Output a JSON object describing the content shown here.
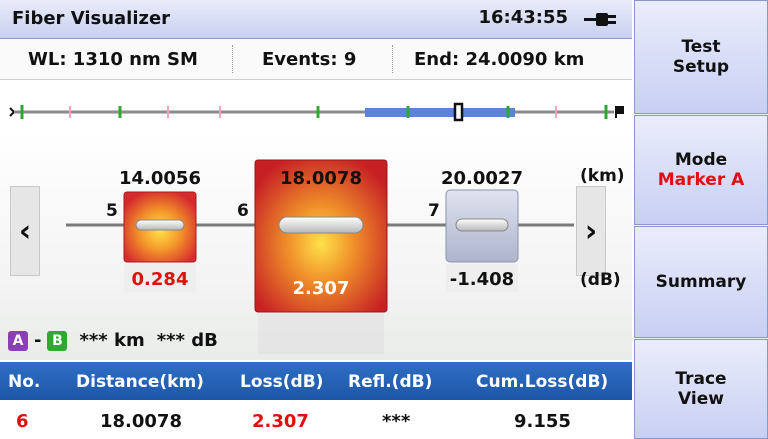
{
  "header": {
    "title": "Fiber Visualizer",
    "time": "16:43:55",
    "power_icon": "plug-icon"
  },
  "info": {
    "wavelength": "WL: 1310 nm SM",
    "events": "Events: 9",
    "end": "End: 24.0090 km"
  },
  "visualizer": {
    "unit_distance": "(km)",
    "unit_loss": "(dB)",
    "events": [
      {
        "number": "5",
        "distance": "14.0056",
        "loss": "0.284",
        "loss_color": "#e01010",
        "box_color": "#d8282e"
      },
      {
        "number": "6",
        "distance": "18.0078",
        "loss": "2.307",
        "loss_color": "#ffffff",
        "box_color": "#c81e22"
      },
      {
        "number": "7",
        "distance": "20.0027",
        "loss": "-1.408",
        "loss_color": "#111111",
        "box_color": "#b9bfd6"
      }
    ],
    "prev_label": "‹",
    "next_label": "›"
  },
  "ab_marker": {
    "a": "A",
    "b": "B",
    "dash": "-",
    "distance": "*** km",
    "loss": "*** dB"
  },
  "table": {
    "headers": [
      "No.",
      "Distance(km)",
      "Loss(dB)",
      "Refl.(dB)",
      "Cum.Loss(dB)"
    ],
    "row": {
      "no": "6",
      "distance": "18.0078",
      "loss": "2.307",
      "refl": "***",
      "cum_loss": "9.155"
    }
  },
  "sidebar": {
    "test_setup": [
      "Test",
      "Setup"
    ],
    "mode": {
      "label": "Mode",
      "value": "Marker A"
    },
    "summary": "Summary",
    "trace_view": [
      "Trace",
      "View"
    ]
  },
  "colors": {
    "accent": "#1d56a8",
    "highlight": "#e01010",
    "title_bg": "#c9d0f0"
  }
}
